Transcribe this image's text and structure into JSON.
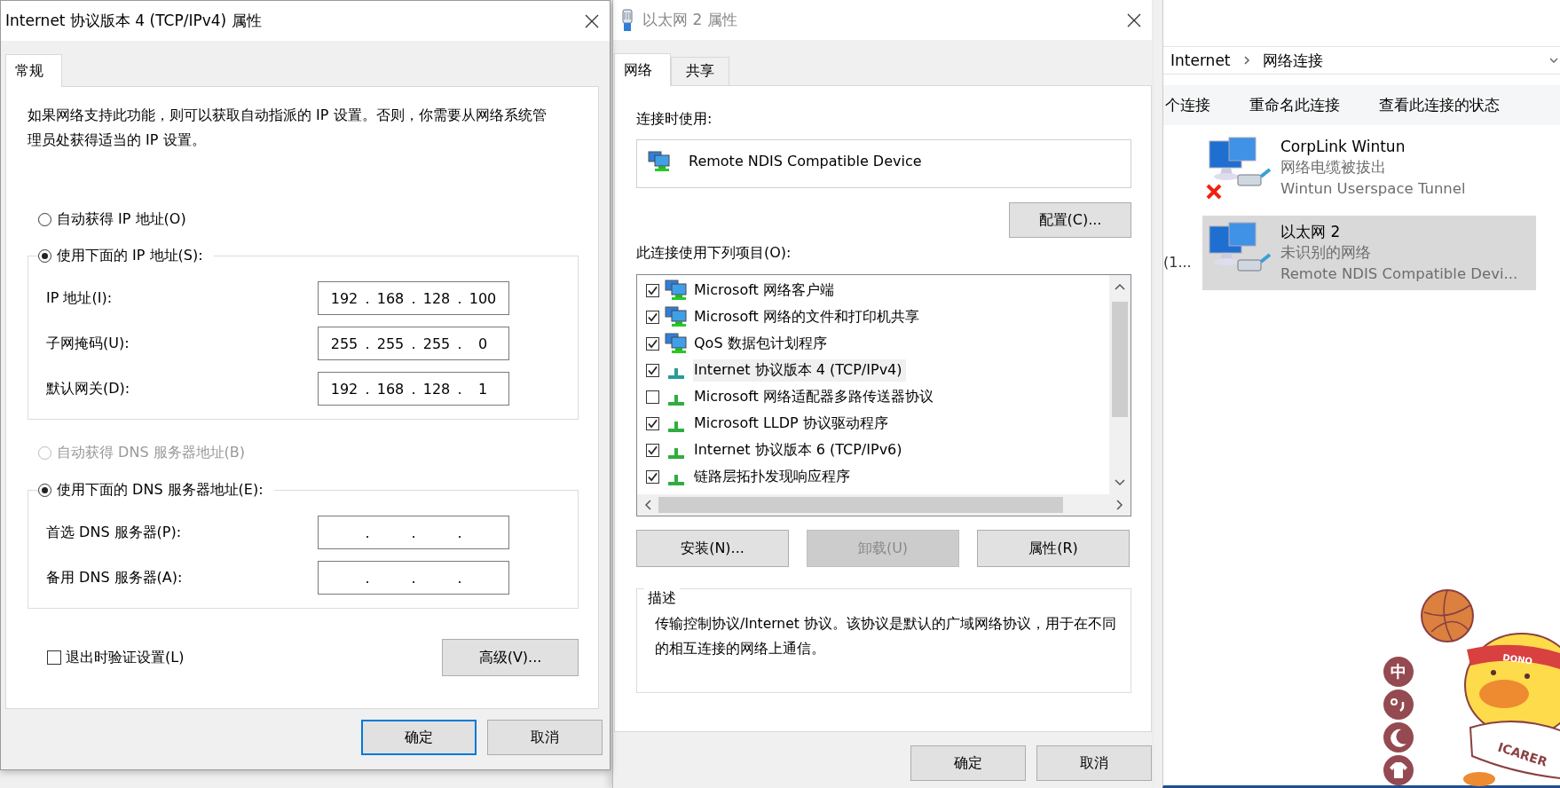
{
  "ipv4_dialog": {
    "title": "Internet 协议版本 4 (TCP/IPv4) 属性",
    "tabs": [
      {
        "label": "常规",
        "selected": true
      }
    ],
    "description": "如果网络支持此功能，则可以获取自动指派的 IP 设置。否则，你需要从网络系统管理员处获得适当的 IP 设置。",
    "ip_mode": [
      {
        "label": "自动获得 IP 地址(O)",
        "selected": false,
        "disabled": false
      },
      {
        "label": "使用下面的 IP 地址(S):",
        "selected": true,
        "disabled": false
      }
    ],
    "ip_fields": [
      {
        "label": "IP 地址(I):",
        "octets": [
          "192",
          "168",
          "128",
          "100"
        ],
        "dots": [
          ".",
          ".",
          "."
        ]
      },
      {
        "label": "子网掩码(U):",
        "octets": [
          "255",
          "255",
          "255",
          "0"
        ],
        "dots": [
          ".",
          ".",
          "."
        ]
      },
      {
        "label": "默认网关(D):",
        "octets": [
          "192",
          "168",
          "128",
          "1"
        ],
        "dots": [
          ".",
          ".",
          "."
        ]
      }
    ],
    "dns_mode": [
      {
        "label": "自动获得 DNS 服务器地址(B)",
        "selected": false,
        "disabled": true
      },
      {
        "label": "使用下面的 DNS 服务器地址(E):",
        "selected": true,
        "disabled": false
      }
    ],
    "dns_fields": [
      {
        "label": "首选 DNS 服务器(P):",
        "dots": [
          ".",
          ".",
          "."
        ]
      },
      {
        "label": "备用 DNS 服务器(A):",
        "dots": [
          ".",
          ".",
          "."
        ]
      }
    ],
    "validate_on_exit": {
      "label": "退出时验证设置(L)",
      "checked": false
    },
    "advanced_button": "高级(V)...",
    "buttons": [
      {
        "label": "确定",
        "default": true
      },
      {
        "label": "取消",
        "default": false
      }
    ]
  },
  "ethernet_dialog": {
    "title": "以太网 2 属性",
    "tabs": [
      {
        "label": "网络",
        "selected": true
      },
      {
        "label": "共享",
        "selected": false
      }
    ],
    "connect_using_label": "连接时使用:",
    "adapter": "Remote NDIS Compatible Device",
    "configure_button": "配置(C)...",
    "items_label": "此连接使用下列项目(O):",
    "items": [
      {
        "label": "Microsoft 网络客户端",
        "kind": "service",
        "checked": true,
        "selected": false
      },
      {
        "label": "Microsoft 网络的文件和打印机共享",
        "kind": "service",
        "checked": true,
        "selected": false
      },
      {
        "label": "QoS 数据包计划程序",
        "kind": "service",
        "checked": true,
        "selected": false
      },
      {
        "label": "Internet 协议版本 4 (TCP/IPv4)",
        "kind": "protocol",
        "checked": true,
        "selected": true
      },
      {
        "label": "Microsoft 网络适配器多路传送器协议",
        "kind": "protocol",
        "checked": false,
        "selected": false
      },
      {
        "label": "Microsoft LLDP 协议驱动程序",
        "kind": "protocol",
        "checked": true,
        "selected": false
      },
      {
        "label": "Internet 协议版本 6 (TCP/IPv6)",
        "kind": "protocol",
        "checked": true,
        "selected": false
      },
      {
        "label": "链路层拓扑发现响应程序",
        "kind": "protocol",
        "checked": true,
        "selected": false
      }
    ],
    "action_buttons": [
      {
        "label": "安装(N)...",
        "disabled": false
      },
      {
        "label": "卸载(U)",
        "disabled": true
      },
      {
        "label": "属性(R)",
        "disabled": false
      }
    ],
    "description_legend": "描述",
    "description": "传输控制协议/Internet 协议。该协议是默认的广域网络协议，用于在不同的相互连接的网络上通信。",
    "buttons": [
      {
        "label": "确定",
        "default": false
      },
      {
        "label": "取消",
        "default": false
      }
    ]
  },
  "explorer": {
    "breadcrumb": [
      "Internet",
      "网络连接"
    ],
    "commands": [
      "个连接",
      "重命名此连接",
      "查看此连接的状态"
    ],
    "cut_label": "(1...",
    "connections": [
      {
        "name": "CorpLink Wintun",
        "status": "网络电缆被拔出",
        "device": "Wintun Userspace Tunnel",
        "disconnected": true,
        "selected": false
      },
      {
        "name": "以太网 2",
        "status": "未识别的网络",
        "device": "Remote NDIS Compatible Devi...",
        "disconnected": false,
        "selected": true
      }
    ]
  },
  "ime_toolbar": {
    "mode_label": "中",
    "mascot_texts": [
      "DONO",
      "ICARER"
    ]
  }
}
